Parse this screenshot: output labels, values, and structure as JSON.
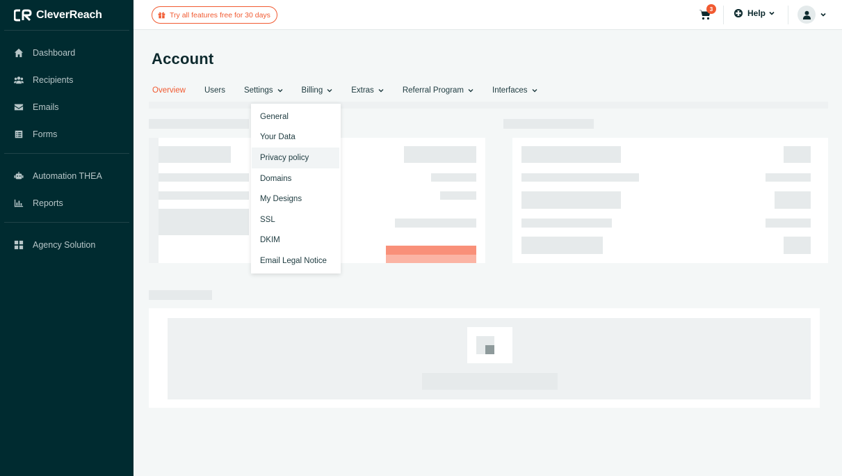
{
  "app": {
    "brand": "CleverReach"
  },
  "sidebar": {
    "groups": [
      [
        {
          "label": "Dashboard",
          "icon": "home-icon"
        },
        {
          "label": "Recipients",
          "icon": "users-icon"
        },
        {
          "label": "Emails",
          "icon": "envelope-icon"
        },
        {
          "label": "Forms",
          "icon": "form-icon"
        }
      ],
      [
        {
          "label": "Automation THEA",
          "icon": "robot-icon"
        },
        {
          "label": "Reports",
          "icon": "chart-icon"
        }
      ],
      [
        {
          "label": "Agency Solution",
          "icon": "grid-icon"
        }
      ]
    ]
  },
  "topbar": {
    "trial_label": "Try all features free for 30 days",
    "cart_count": "3",
    "help_label": "Help"
  },
  "main": {
    "title": "Account",
    "tabs": [
      {
        "label": "Overview",
        "active": true
      },
      {
        "label": "Users"
      },
      {
        "label": "Settings",
        "dropdown": true
      },
      {
        "label": "Billing",
        "dropdown": true
      },
      {
        "label": "Extras",
        "dropdown": true
      },
      {
        "label": "Referral Program",
        "dropdown": true
      },
      {
        "label": "Interfaces",
        "dropdown": true
      }
    ]
  },
  "settings_menu": {
    "items": [
      "General",
      "Your Data",
      "Privacy policy",
      "Domains",
      "My Designs",
      "SSL",
      "DKIM",
      "Email Legal Notice"
    ],
    "hovered": "Privacy policy"
  },
  "colors": {
    "accent": "#f15a31",
    "sidebar": "#002b30"
  }
}
